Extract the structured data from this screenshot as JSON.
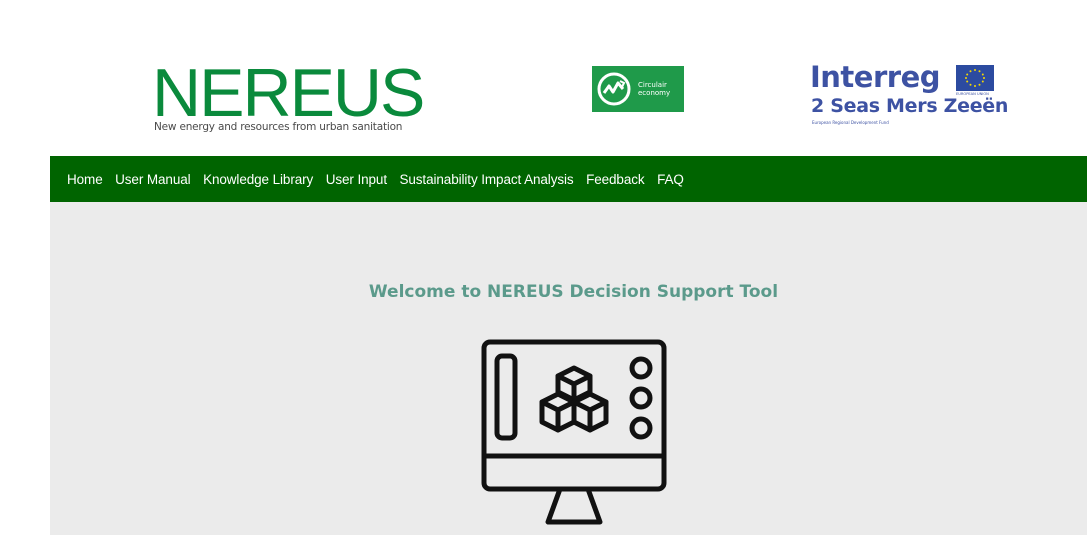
{
  "header": {
    "nereus_logo": {
      "wordmark": "NEREUS",
      "tagline": "New energy and resources from urban sanitation"
    },
    "circular_logo": {
      "line1": "Circulair",
      "line2": "economy"
    },
    "interreg_logo": {
      "name": "Interreg",
      "program": "2 Seas Mers Zeeën",
      "fund": "European Regional Development Fund",
      "eu_caption": "EUROPEAN UNION"
    }
  },
  "nav": {
    "items": [
      {
        "label": "Home"
      },
      {
        "label": "User Manual"
      },
      {
        "label": "Knowledge Library"
      },
      {
        "label": "User Input"
      },
      {
        "label": "Sustainability Impact Analysis"
      },
      {
        "label": "Feedback"
      },
      {
        "label": "FAQ"
      }
    ]
  },
  "main": {
    "welcome_title": "Welcome to NEREUS Decision Support Tool",
    "icon": "monitor-blocks-icon"
  },
  "colors": {
    "nav_bg": "#006400",
    "nereus_green": "#0a8a3c",
    "circular_green": "#1f9a4a",
    "interreg_blue": "#3d52a3",
    "welcome_text": "#5b9a8b",
    "main_bg": "#ebebeb"
  }
}
